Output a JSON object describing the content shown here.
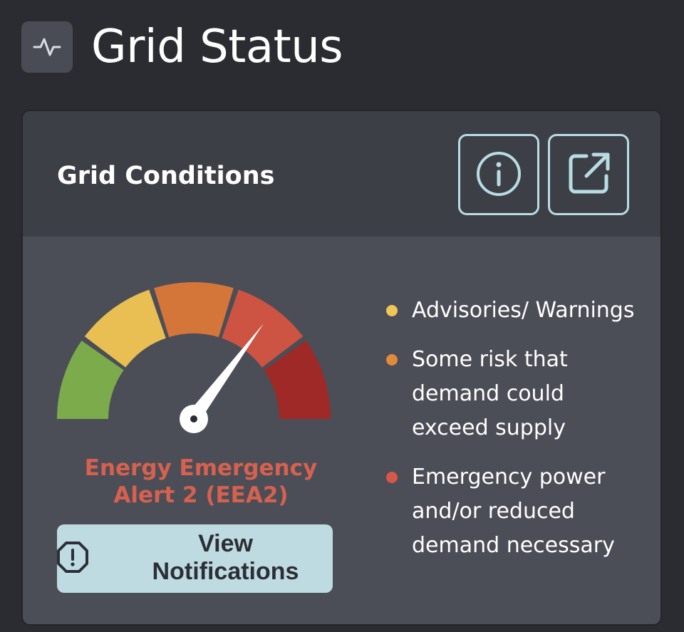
{
  "header": {
    "title": "Grid Status",
    "icon": "activity-pulse-icon"
  },
  "card": {
    "title": "Grid Conditions",
    "info_icon": "info-icon",
    "external_icon": "external-link-icon"
  },
  "gauge": {
    "segments": [
      {
        "level": "normal",
        "color": "#7bab4a"
      },
      {
        "level": "advisory",
        "color": "#e9bf53"
      },
      {
        "level": "some-risk",
        "color": "#d4753a"
      },
      {
        "level": "emergency",
        "color": "#cd5443"
      },
      {
        "level": "critical",
        "color": "#9e2927"
      }
    ],
    "active_segment": 3
  },
  "status": {
    "label": "Energy Emergency Alert 2 (EEA2)",
    "color": "#d6614f"
  },
  "notifications_button": {
    "label": "View Notifications",
    "icon": "alert-octagon-icon"
  },
  "legend": [
    {
      "color": "#f2c654",
      "text": "Advisories/ Warnings"
    },
    {
      "color": "#e08a3c",
      "text": "Some risk that demand could exceed supply"
    },
    {
      "color": "#d6584a",
      "text": "Emergency power and/or reduced demand necessary"
    }
  ]
}
